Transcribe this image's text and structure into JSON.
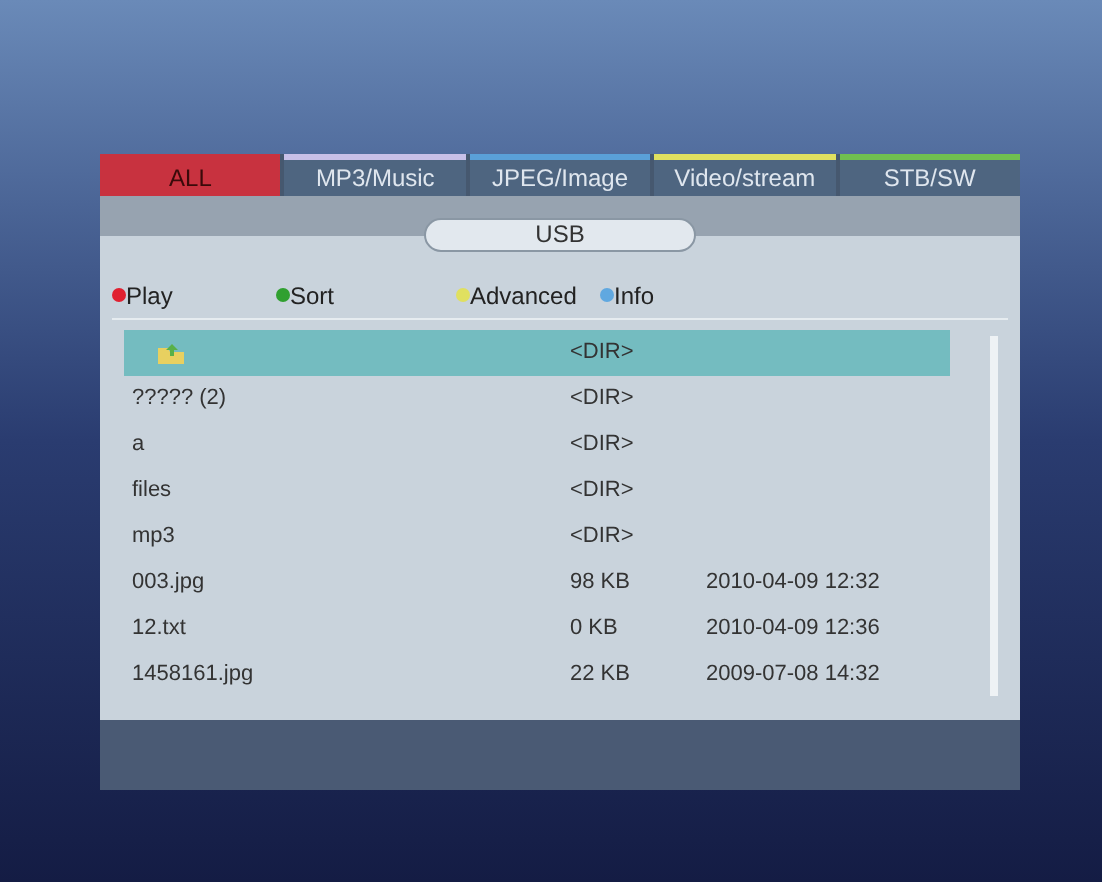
{
  "tabs": [
    {
      "label": "ALL",
      "selected": true,
      "color": "#c8323f"
    },
    {
      "label": "MP3/Music",
      "selected": false,
      "color": "#c8c0e8"
    },
    {
      "label": "JPEG/Image",
      "selected": false,
      "color": "#5aa0d8"
    },
    {
      "label": "Video/stream",
      "selected": false,
      "color": "#e0e060"
    },
    {
      "label": "STB/SW",
      "selected": false,
      "color": "#70c050"
    }
  ],
  "device": "USB",
  "legend": [
    {
      "label": "Play",
      "color": "#e02030"
    },
    {
      "label": "Sort",
      "color": "#30a030"
    },
    {
      "label": "Advanced",
      "color": "#e0e060"
    },
    {
      "label": "Info",
      "color": "#60a8e0"
    }
  ],
  "files": [
    {
      "kind": "up",
      "size": "<DIR>",
      "selected": true
    },
    {
      "kind": "folder",
      "name": "????? (2)",
      "size": "<DIR>",
      "selected": false
    },
    {
      "kind": "folder",
      "name": "a",
      "size": "<DIR>",
      "selected": false
    },
    {
      "kind": "folder",
      "name": "files",
      "size": "<DIR>",
      "selected": false
    },
    {
      "kind": "folder",
      "name": "mp3",
      "size": "<DIR>",
      "selected": false
    },
    {
      "kind": "file",
      "name": "003.jpg",
      "size": "98 KB",
      "date": "2010-04-09 12:32",
      "selected": false
    },
    {
      "kind": "file",
      "name": "12.txt",
      "size": "0 KB",
      "date": "2010-04-09 12:36",
      "selected": false
    },
    {
      "kind": "file",
      "name": "1458161.jpg",
      "size": "22 KB",
      "date": "2009-07-08 14:32",
      "selected": false
    }
  ]
}
